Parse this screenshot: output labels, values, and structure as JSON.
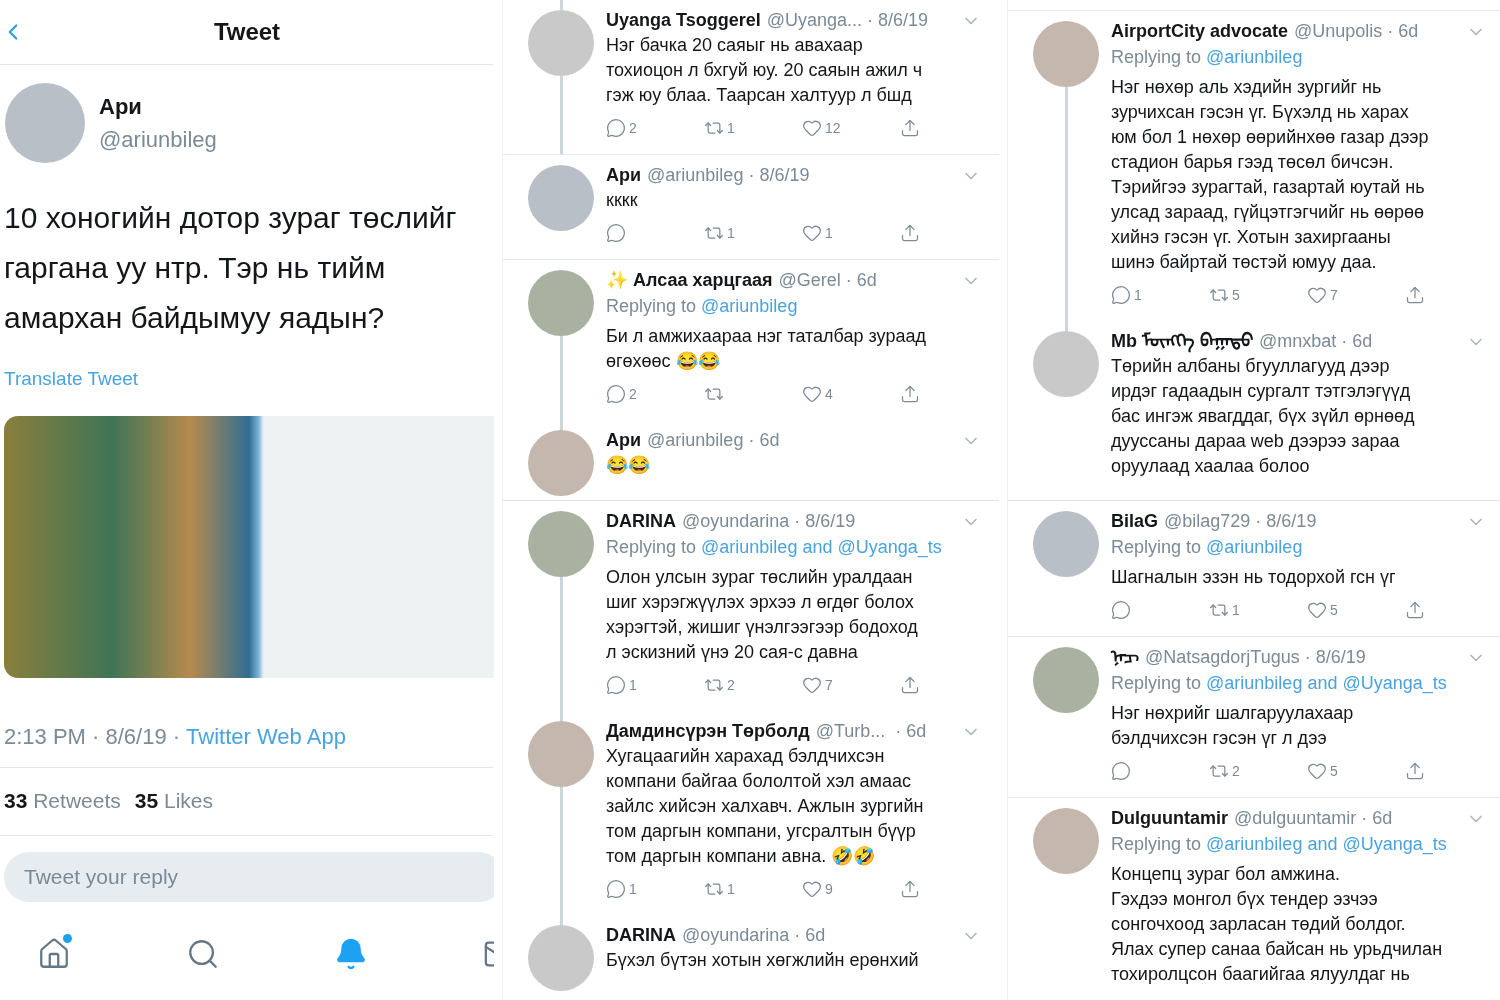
{
  "tweet_screen": {
    "title": "Tweet",
    "author": {
      "name": "Ари",
      "handle": "@ariunbileg"
    },
    "text": "10 хоногийн дотор зураг төслийг гаргана уу нтр. Тэр нь тийм амархан байдымуу яадын?",
    "translate": "Translate Tweet",
    "timestamp": "2:13 PM · 8/6/19 ·",
    "source": "Twitter Web App",
    "stats": [
      {
        "count": "33",
        "label": "Retweets"
      },
      {
        "count": "35",
        "label": "Likes"
      }
    ],
    "reply_placeholder": "Tweet your reply",
    "tabs": [
      {
        "selected": false,
        "badge": true
      },
      {
        "selected": false
      },
      {
        "selected": true
      },
      {
        "selected": false
      }
    ]
  },
  "columns": [
    {
      "panels": [
        {
          "items": [
            {
              "name": "Uyanga Tsoggerel",
              "meta": "@Uyanga... · 8/6/19",
              "text": "Нэг бачка 20 саяыг нь авахаар\nтохиоцон л бхгуй юу. 20 саяын ажил ч\nгэж юу блаа. Таарсан халтуур л бшд",
              "line_above": true,
              "line_below": true,
              "actions": {
                "reply": "2",
                "retweet": "1",
                "like": "12"
              }
            },
            {
              "name": "Ари",
              "meta": "@ariunbileg · 8/6/19",
              "text": "кккк",
              "line_above": false,
              "line_below": false,
              "actions": {
                "retweet": "1",
                "like": "1"
              }
            },
            {
              "name": "✨ Алсаа харцгаая",
              "meta": "@Gerel · 6d",
              "replying_label": "Replying to",
              "replying_to": "@ariunbileg",
              "text": "Би л амжихаараа нэг таталбар зураад\nөгөхөөс 😂😂",
              "line_above": false,
              "line_below": true,
              "actions": {
                "reply": "2",
                "like": "4"
              }
            },
            {
              "name": "Ари",
              "meta": "@ariunbileg · 6d",
              "text": "😂😂",
              "line_above": true,
              "line_below": false
            }
          ]
        },
        {
          "items": [
            {
              "name": "DARINA",
              "meta": "@oyundarina · 8/6/19",
              "replying_label": "Replying to",
              "replying_to": "@ariunbileg and @Uyanga_ts",
              "text": "Олон улсын зураг төслийн уралдаан\nшиг хэрэгжүүлэх эрхээ л өгдөг болох\nхэрэгтэй, жишиг үнэлгээгээр бодоход\nл эскизний үнэ 20 сая-с давна",
              "line_above": false,
              "line_below": true,
              "actions": {
                "reply": "1",
                "retweet": "2",
                "like": "7"
              }
            },
            {
              "name": "Дамдинсүрэн Төрболд",
              "meta": "@Turb...  · 6d",
              "text": "Хугацаагийн харахад бэлдчихсэн\nкомпани байгаа бололтой хэл амаас\nзайлс хийсэн халхавч. Ажлын зургийн\nтом даргын компани, угсралтын бүүр\nтом даргын компани авна. 🤣🤣",
              "line_above": true,
              "line_below": true,
              "actions": {
                "reply": "1",
                "retweet": "1",
                "like": "9"
              }
            },
            {
              "name": "DARINA",
              "meta": "@oyundarina · 6d",
              "text": "Бүхэл бүтэн хотын хөгжлийн ерөнхий",
              "line_above": true,
              "line_below": false
            }
          ]
        }
      ]
    },
    {
      "panels": [
        {
          "items": [
            {
              "name": "AirportCity advocate",
              "meta": "@Unupolis · 6d",
              "replying_label": "Replying to",
              "replying_to": "@ariunbileg",
              "text": "Нэг нөхөр аль хэдийн зургийг нь\nзурчихсан гэсэн үг. Бүхэлд нь харах\nюм бол 1 нөхөр өөрийнхөө газар дээр\nстадион барья гээд төсөл бичсэн.\nТэрийгээ зурагтай, газартай юутай нь\nулсад зараад, гүйцэтгэгчийг нь өөрөө\nхийнэ гэсэн үг. Хотын захиргааны\nшинэ байртай төстэй юмуу даа.",
              "line_above": false,
              "line_below": true,
              "actions": {
                "reply": "1",
                "retweet": "5",
                "like": "7"
              }
            },
            {
              "name": "Мb ᠮᠥᠩᠬᠡ ᠪᠠᠭᠠᠲᠤ",
              "meta": "@mnxbat · 6d",
              "text": "Төрийн албаны бгууллагууд дээр\nирдэг гадаадын сургалт тэтгэлэгүүд\nбас ингэж явагддаг, бүх зүйл өрнөөд\nдууссаны дараа web дээрээ зараа\nоруулаад хаалаа болоо",
              "line_above": true,
              "line_below": false
            }
          ]
        },
        {
          "items": [
            {
              "name": "BilaG",
              "meta": "@bilag729 · 8/6/19",
              "replying_label": "Replying to",
              "replying_to": "@ariunbileg",
              "text": "Шагналын эзэн нь тодорхой гсн үг",
              "line_above": false,
              "line_below": false,
              "actions": {
                "retweet": "1",
                "like": "5"
              }
            },
            {
              "name": "ᠨᠠᠴ",
              "meta": "@NatsagdorjTugus · 8/6/19",
              "replying_label": "Replying to",
              "replying_to": "@ariunbileg and @Uyanga_ts",
              "text": "Нэг нөхрийг шалгаруулахаар\nбэлдчихсэн гэсэн үг л дээ",
              "line_above": false,
              "line_below": false,
              "actions": {
                "retweet": "2",
                "like": "5"
              }
            },
            {
              "name": "Dulguuntamir",
              "meta": "@dulguuntamir · 6d",
              "replying_label": "Replying to",
              "replying_to": "@ariunbileg and @Uyanga_ts",
              "text": "Концепц зураг бол амжина.\nГэхдээ монгол бүх тендер эзчээ\nсонгочхоод зарласан төдий болдог.\nЯлах супер санаа байсан нь урьдчилан\nтохиролцсон баагийгаа ялуулдаг нь",
              "line_above": false,
              "line_below": false
            }
          ]
        }
      ]
    }
  ]
}
